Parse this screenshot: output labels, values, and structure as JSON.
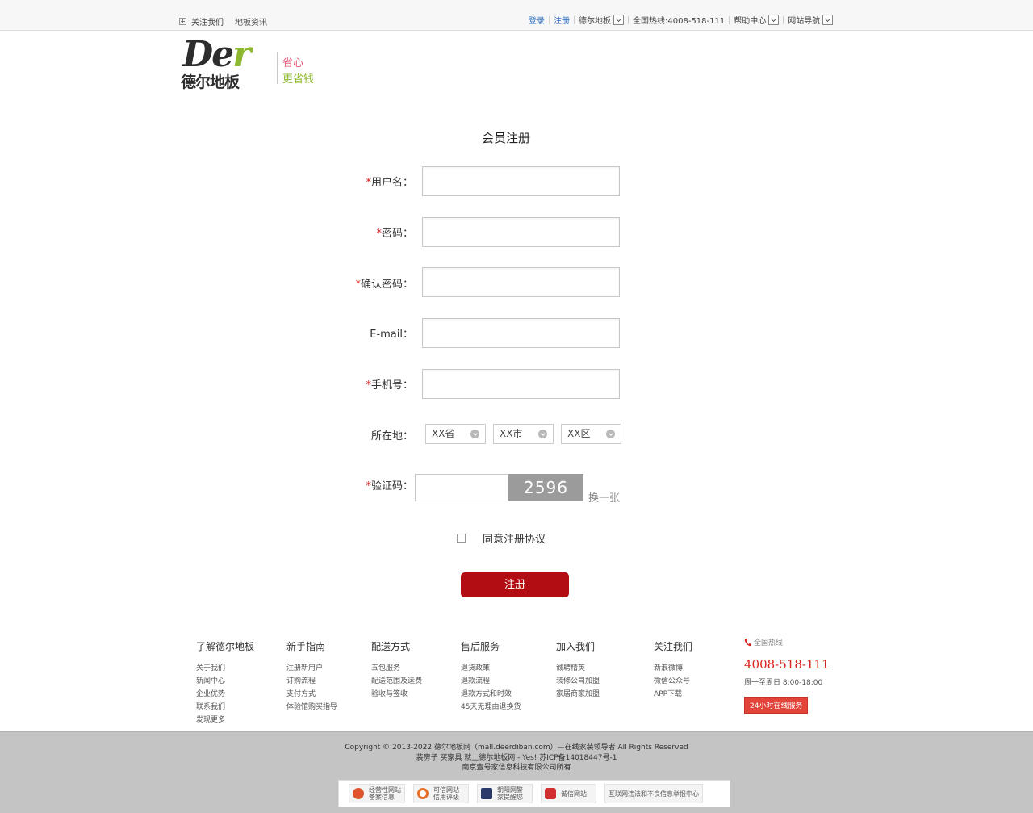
{
  "topbar": {
    "follow": "关注我们",
    "news": "地板资讯",
    "login": "登录",
    "register": "注册",
    "brand": "德尔地板",
    "hotline": "全国热线:4008-518-111",
    "help": "帮助中心",
    "sitenav": "网站导航"
  },
  "logo": {
    "der_main": "De",
    "der_r": "r",
    "cn": "德尔地板",
    "slogan1": "省心",
    "slogan2": "更省钱"
  },
  "form": {
    "title": "会员注册",
    "req": "*",
    "username_label": "用户名：",
    "password_label": "密码：",
    "confirm_label": "确认密码：",
    "email_label": "E-mail：",
    "phone_label": "手机号：",
    "region_label": "所在地：",
    "province": "XX省",
    "city": "XX市",
    "district": "XX区",
    "captcha_label": "验证码：",
    "captcha_code": "2596",
    "captcha_refresh": "换一张",
    "agree": "同意注册协议",
    "submit": "注册"
  },
  "footer": {
    "cols": [
      {
        "title": "了解德尔地板",
        "links": [
          "关于我们",
          "新闻中心",
          "企业优势",
          "联系我们",
          "发现更多"
        ]
      },
      {
        "title": "新手指南",
        "links": [
          "注册新用户",
          "订购流程",
          "支付方式",
          "体验馆购买指导"
        ]
      },
      {
        "title": "配送方式",
        "links": [
          "五包服务",
          "配送范围及运费",
          "验收与签收"
        ]
      },
      {
        "title": "售后服务",
        "links": [
          "退货政策",
          "退款流程",
          "退款方式和时效",
          "45天无理由退换货"
        ]
      },
      {
        "title": "加入我们",
        "links": [
          "诚聘精英",
          "装修公司加盟",
          "家居商家加盟"
        ]
      },
      {
        "title": "关注我们",
        "links": [
          "新浪微博",
          "微信公众号",
          "APP下载"
        ]
      }
    ],
    "hotline_title": "全国热线",
    "hotline_number": "4008-518-111",
    "hours": "周一至周日 8:00-18:00",
    "online": "24小时在线服务",
    "copyright1": "Copyright © 2013-2022 德尔地板网（mall.deerdiban.com）—在线家装领导者 All Rights Reserved",
    "copyright2": "装房子 买家具 就上德尔地板网 - Yes! 苏ICP备14018447号-1",
    "copyright3": "南京壹号家信息科技有限公司所有",
    "badges": [
      {
        "l1": "经营性网站",
        "l2": "备案信息",
        "color": "#e0542d"
      },
      {
        "l1": "可信网站",
        "l2": "信用评级",
        "color": "#e8702a"
      },
      {
        "l1": "朝阳网警",
        "l2": "家提醒您",
        "color": "#2a3a6b"
      },
      {
        "l1": "诚信网站",
        "l2": "",
        "color": "#d23030"
      },
      {
        "l1": "互联网违法和不良信息举报中心",
        "l2": "",
        "color": ""
      }
    ]
  }
}
